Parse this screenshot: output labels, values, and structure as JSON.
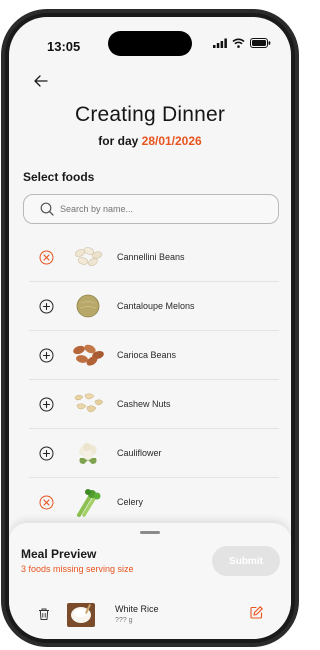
{
  "status_bar": {
    "time": "13:05"
  },
  "header": {
    "title": "Creating Dinner",
    "subtitle_prefix": "for day",
    "date": "28/01/2026"
  },
  "foods_section": {
    "label": "Select foods"
  },
  "search": {
    "placeholder": "Search by name..."
  },
  "foods": [
    {
      "name": "Cannellini Beans",
      "selected": true,
      "icon": "cannellini-beans-icon"
    },
    {
      "name": "Cantaloupe Melons",
      "selected": false,
      "icon": "cantaloupe-icon"
    },
    {
      "name": "Carioca Beans",
      "selected": false,
      "icon": "carioca-beans-icon"
    },
    {
      "name": "Cashew Nuts",
      "selected": false,
      "icon": "cashew-icon"
    },
    {
      "name": "Cauliflower",
      "selected": false,
      "icon": "cauliflower-icon"
    },
    {
      "name": "Celery",
      "selected": true,
      "icon": "celery-icon"
    }
  ],
  "meal_preview": {
    "title": "Meal Preview",
    "warning": "3 foods missing serving size",
    "submit_label": "Submit",
    "items": [
      {
        "name": "White Rice",
        "amount": "??? g"
      }
    ]
  },
  "colors": {
    "accent": "#e8541f",
    "background": "#f6f6f6",
    "submit_disabled": "#e3e3e3"
  }
}
